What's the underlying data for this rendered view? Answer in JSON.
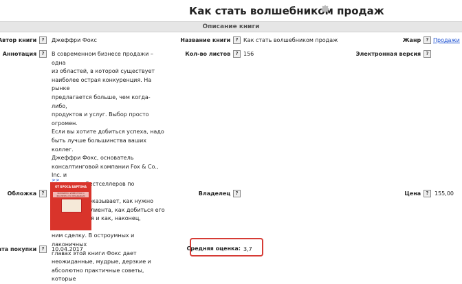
{
  "page": {
    "title": "Как стать волшебником продаж",
    "section_header": "Описание книги"
  },
  "icons": {
    "settings": "gear-icon",
    "help": "question-mark-icon"
  },
  "help_mark": "?",
  "fields": {
    "author": {
      "label": "Автор книги",
      "value": "Джеффри Фокс"
    },
    "book_title": {
      "label": "Название книги",
      "value": "Как стать волшебником продаж"
    },
    "genre": {
      "label": "Жанр",
      "value": "Продажи"
    },
    "annotation": {
      "label": "Аннотация",
      "lines": [
        "В современном бизнесе продажи – одна",
        "из областей, в которой существует",
        "наиболее острая конкуренция. На рынке",
        "предлагается больше, чем когда-либо,",
        "продуктов и услуг. Выбор просто огромен.",
        "Если вы хотите добиться успеха, надо",
        "быть лучше большинства ваших коллег.",
        "Джеффри Фокс, основатель",
        "консалтинговой компании Fox & Co., Inc. и",
        "автор ряда бестселлеров по маркетингу и",
        "продажам, показывает, как нужно",
        "привлекать клиента, как добиться его",
        "расположения и как, наконец, заключать с",
        "ним сделку. В остроумных и лаконичных",
        "главах этой книги Фокс дает",
        "неожиданные, мудрые, дерзкие и",
        "абсолютно практичные советы, которые"
      ],
      "more": ">>"
    },
    "pages": {
      "label": "Кол-во листов",
      "value": "156"
    },
    "electronic": {
      "label": "Электронная версия",
      "value": ""
    },
    "cover": {
      "label": "Обложка",
      "line1": "ОТ БРОСА БАРТОНА",
      "line2": "ВСЕМИРНО ИЗВЕСТНОГО",
      "line3": "ЭКСПЕРТА ПО ПРОДАЖАМ"
    },
    "owner": {
      "label": "Владелец",
      "value": ""
    },
    "price": {
      "label": "Цена",
      "value": "155,00"
    },
    "purchase_date": {
      "label": "Дата покупки",
      "value": "10.04.2017"
    },
    "rating": {
      "label": "Средняя оценка:",
      "value": "3,7"
    }
  },
  "colors": {
    "accent_link": "#1a4fd1",
    "highlight_border": "#d63b35",
    "cover_red": "#d9342b"
  }
}
